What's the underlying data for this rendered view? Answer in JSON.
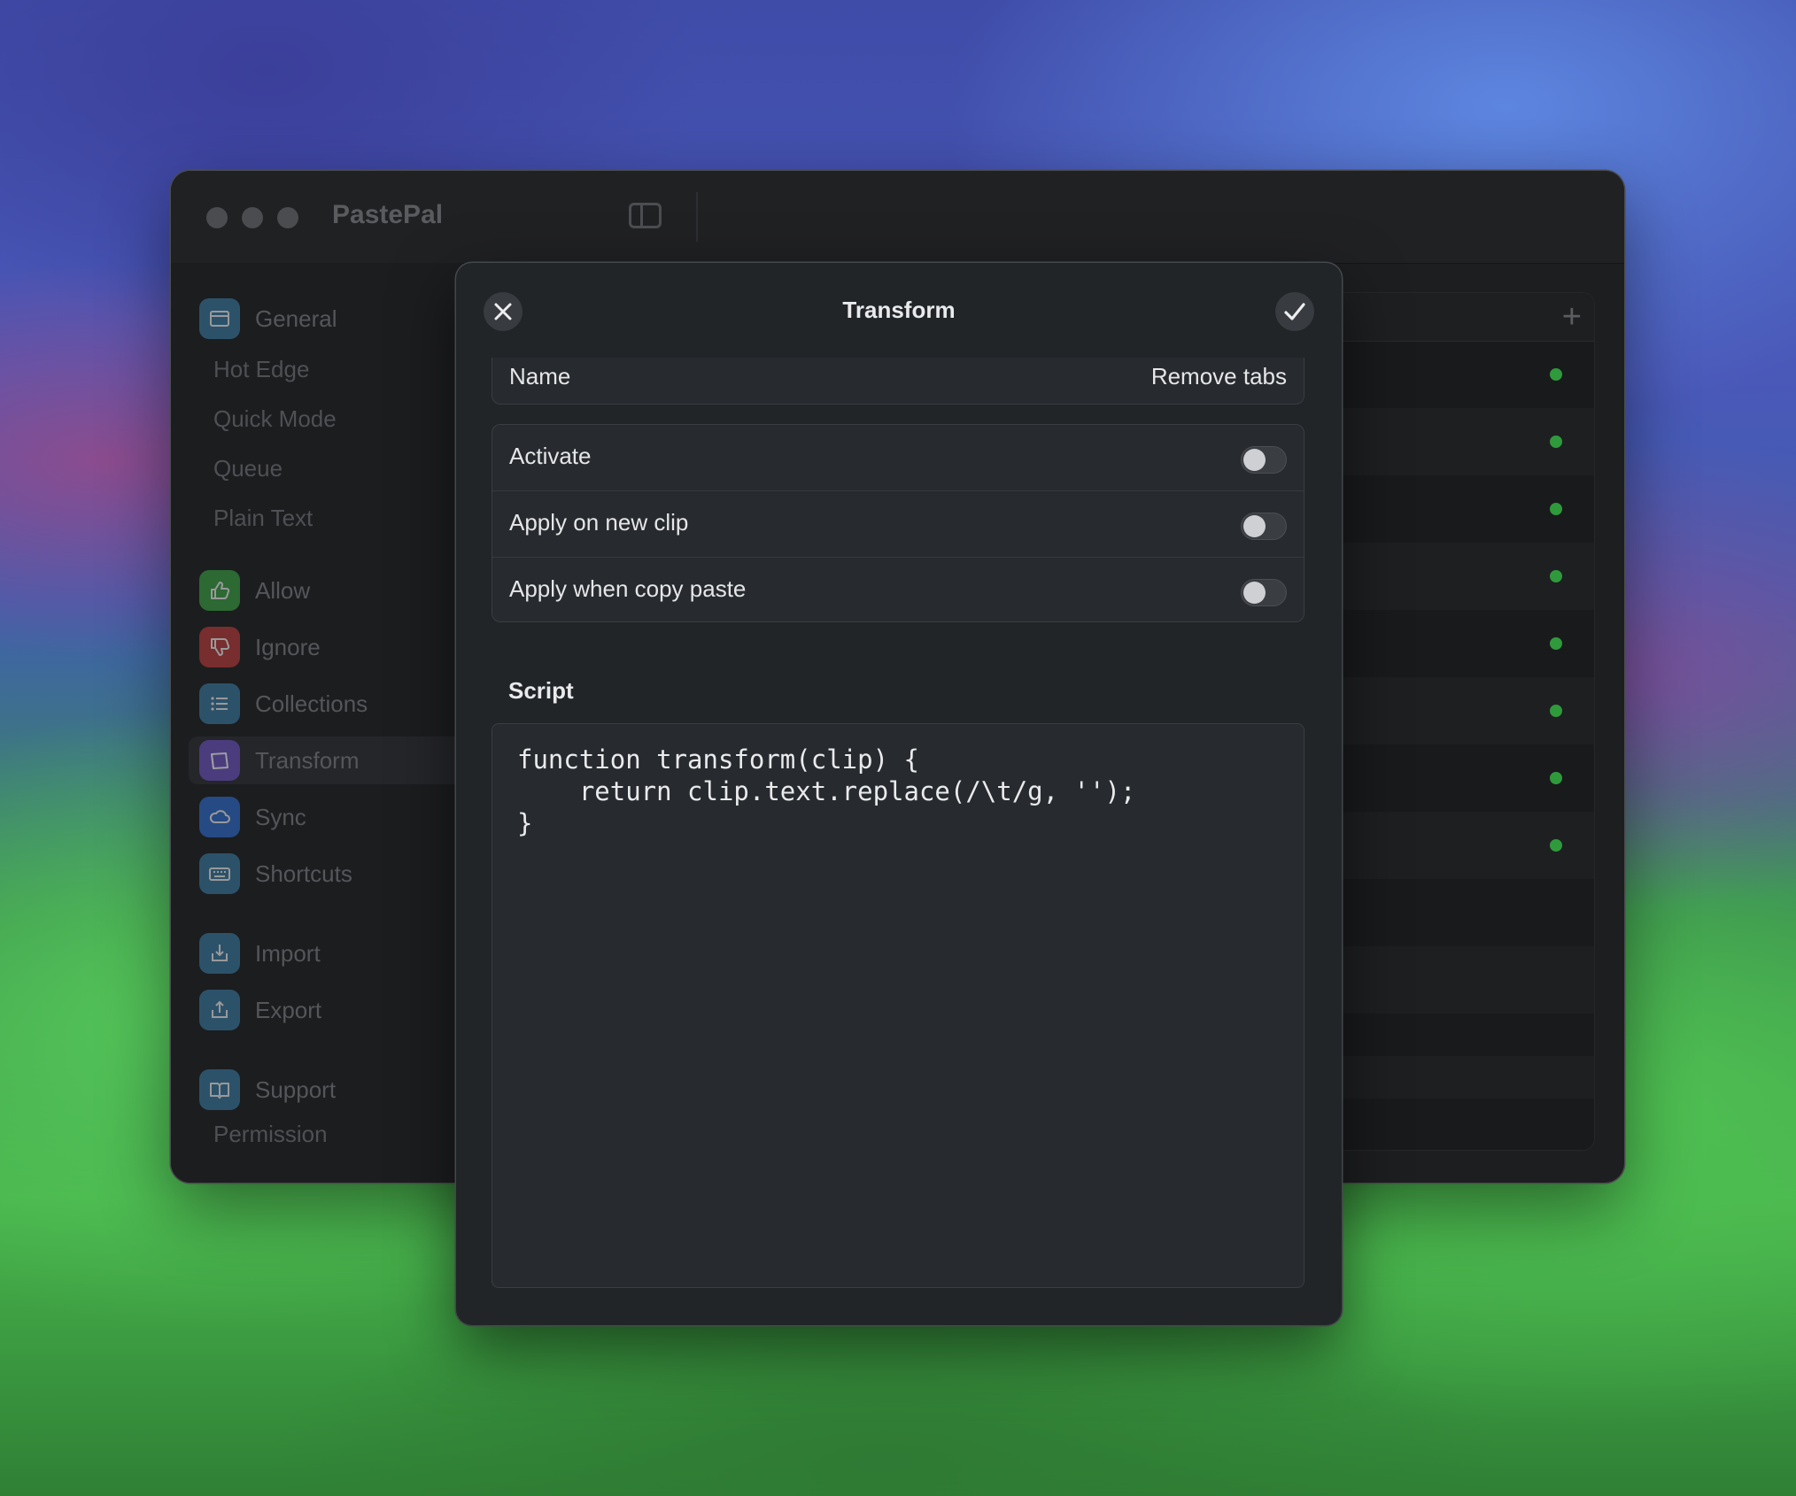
{
  "window": {
    "app_title": "PastePal"
  },
  "sidebar": {
    "items": [
      {
        "label": "General",
        "icon": "window-icon",
        "color": "#3a7fa8"
      },
      {
        "label": "Hot Edge"
      },
      {
        "label": "Quick Mode"
      },
      {
        "label": "Queue"
      },
      {
        "label": "Plain Text"
      },
      {
        "label": "Allow",
        "icon": "thumbs-up-icon",
        "color": "#3aa845"
      },
      {
        "label": "Ignore",
        "icon": "thumbs-down-icon",
        "color": "#c43b3b"
      },
      {
        "label": "Collections",
        "icon": "list-icon",
        "color": "#3a7fa8"
      },
      {
        "label": "Transform",
        "icon": "transform-icon",
        "color": "#6a4fc4",
        "selected": true
      },
      {
        "label": "Sync",
        "icon": "cloud-icon",
        "color": "#2f6fd6"
      },
      {
        "label": "Shortcuts",
        "icon": "keyboard-icon",
        "color": "#3a7fa8"
      },
      {
        "label": "Import",
        "icon": "import-icon",
        "color": "#3a7fa8"
      },
      {
        "label": "Export",
        "icon": "export-icon",
        "color": "#3a7fa8"
      },
      {
        "label": "Support",
        "icon": "support-icon",
        "color": "#3a7fa8"
      },
      {
        "label": "Permission"
      }
    ]
  },
  "sheet": {
    "title": "Transform",
    "name_label": "Name",
    "name_value": "Remove tabs",
    "options": [
      {
        "label": "Activate",
        "on": false
      },
      {
        "label": "Apply on new clip",
        "on": false
      },
      {
        "label": "Apply when copy paste",
        "on": false
      }
    ],
    "script_label": "Script",
    "script_code": "function transform(clip) {\n    return clip.text.replace(/\\t/g, '');\n}"
  },
  "colors": {
    "status_dot": "#2f9a3c"
  }
}
